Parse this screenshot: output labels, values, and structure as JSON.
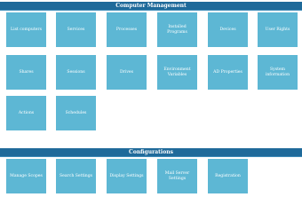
{
  "sections": {
    "computer_management": {
      "title": "Computer Management",
      "tiles": [
        "List computers",
        "Services",
        "Processes",
        "Installed Programs",
        "Devices",
        "User Rights",
        "Shares",
        "Sessions",
        "Drives",
        "Environment Variables",
        "AD Properties",
        "System information",
        "Actions",
        "Schedules"
      ]
    },
    "configurations": {
      "title": "Configurations",
      "tiles": [
        "Manage Scopes",
        "Search Settings",
        "Display Settings",
        "Mail Server Settings",
        "Registration"
      ]
    }
  },
  "colors": {
    "header_background": "#1f6a9a",
    "tile_background": "#5db7d4",
    "tile_text": "#ffffff"
  }
}
